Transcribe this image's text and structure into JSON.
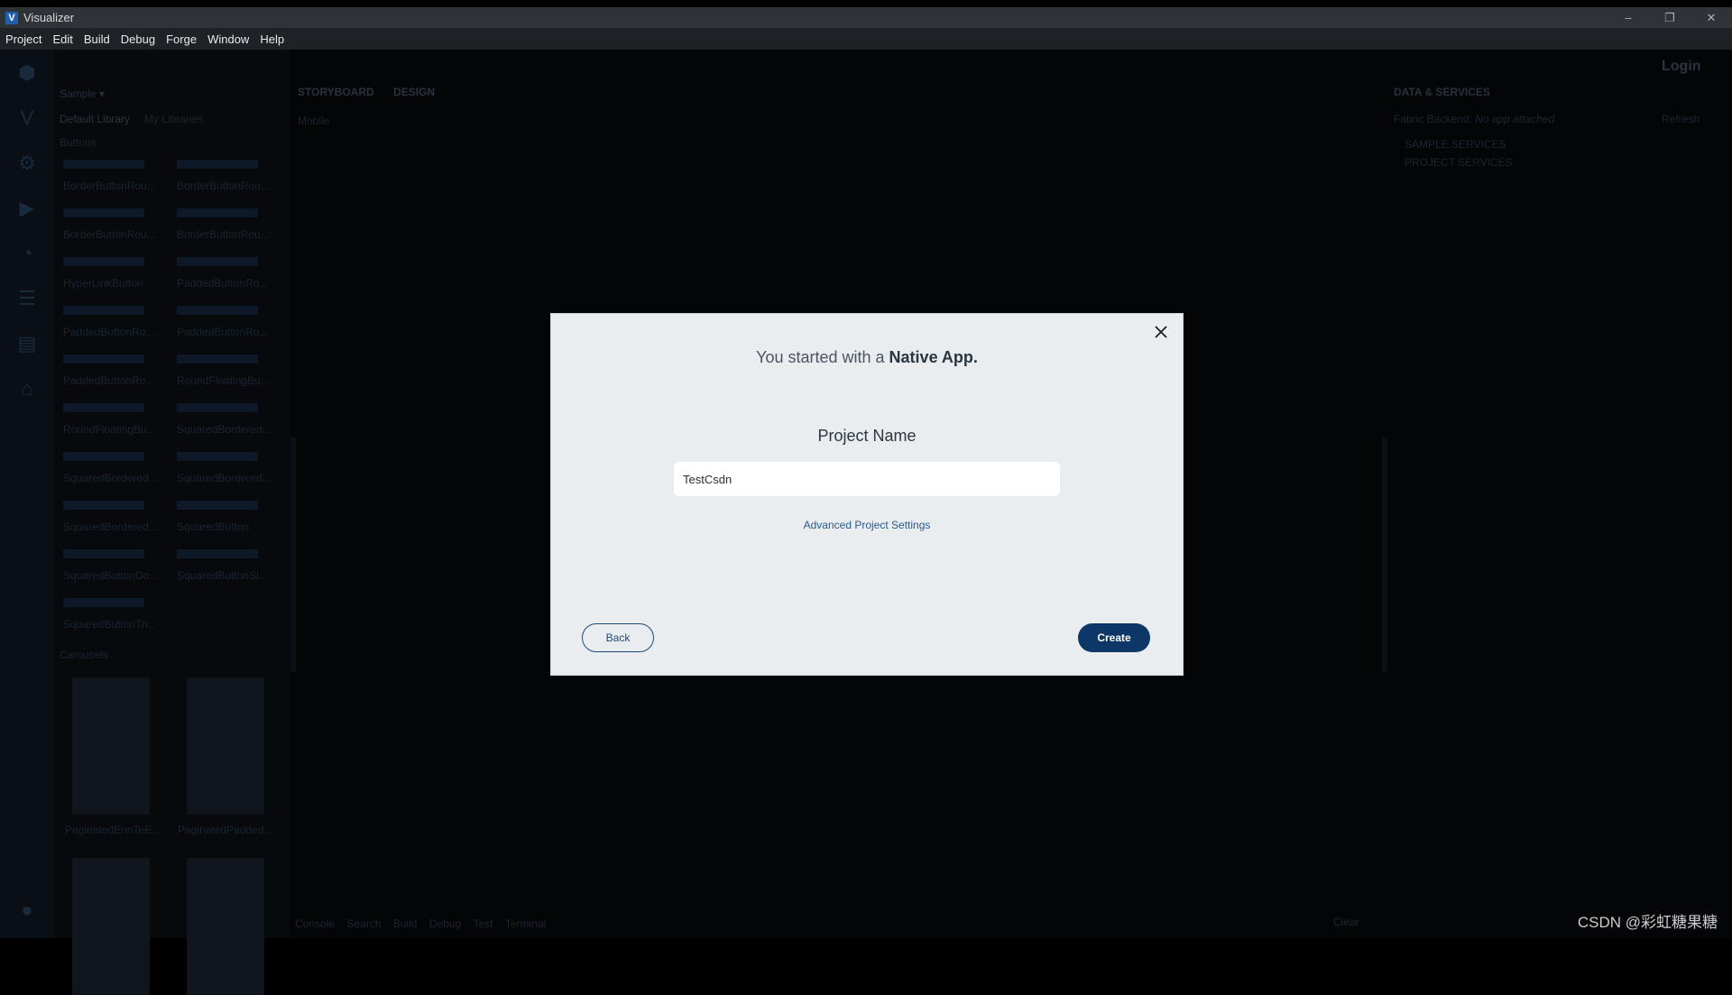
{
  "window": {
    "title": "Visualizer",
    "controls": {
      "minimize": "–",
      "restore": "❐",
      "close": "✕"
    }
  },
  "menubar": {
    "items": [
      "Project",
      "Edit",
      "Build",
      "Debug",
      "Forge",
      "Window",
      "Help"
    ]
  },
  "background": {
    "project_dropdown": "Sample ▾",
    "library_tabs": [
      "Default Library",
      "My Libraries"
    ],
    "section_buttons": "Buttons",
    "section_carousels": "Carousels",
    "library_items": [
      "BorderButtonRou...",
      "BorderButtonRou...",
      "BorderButtonRou...",
      "BorderButtonRou...",
      "HyperLinkButton",
      "PaddedButtonRo...",
      "PaddedButtonRo...",
      "PaddedButtonRo...",
      "PaddedButtonRo...",
      "RoundFloatingBu...",
      "RoundFloatingBu...",
      "SquaredBordered...",
      "SquaredBordered...",
      "SquaredBordered...",
      "SquaredBordered...",
      "SquaredButton",
      "SquaredButtonDo...",
      "SquaredButtonSi...",
      "SquaredButtonTri..."
    ],
    "carousel_items": [
      "PaginatedEnnTeE...",
      "PaginatedPadded..."
    ],
    "storyboard_tabs": [
      "STORYBOARD",
      "DESIGN"
    ],
    "device_label": "Mobile",
    "right_panel": {
      "title": "DATA & SERVICES",
      "backend_label": "Fabric Backend:",
      "backend_value": "No app attached",
      "refresh": "Refresh",
      "tree": [
        "SAMPLE SERVICES",
        "PROJECT SERVICES"
      ]
    },
    "login": "Login",
    "bottom_tabs": [
      "Console",
      "Search",
      "Build",
      "Debug",
      "Test",
      "Terminal"
    ],
    "clear": "Clear"
  },
  "modal": {
    "headline_prefix": "You started with a",
    "headline_bold": "Native App.",
    "field_label": "Project Name",
    "project_name_value": "TestCsdn",
    "advanced_link": "Advanced Project Settings",
    "back_label": "Back",
    "create_label": "Create"
  },
  "watermark": "CSDN @彩虹糖果糖"
}
